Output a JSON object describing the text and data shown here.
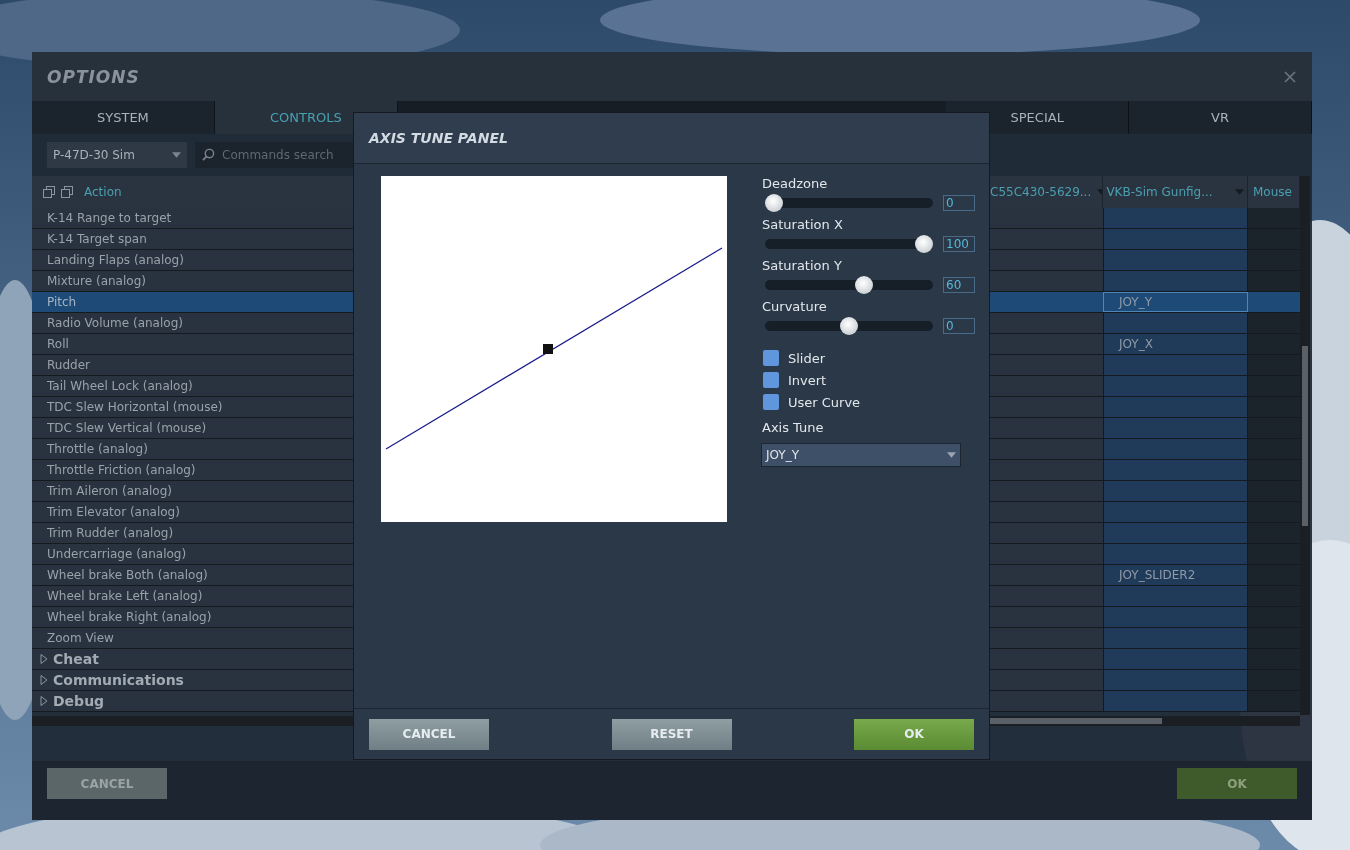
{
  "window": {
    "title": "OPTIONS"
  },
  "tabs": [
    {
      "label": "SYSTEM",
      "selected": false
    },
    {
      "label": "CONTROLS",
      "selected": true
    },
    {
      "label": "SPECIAL",
      "selected": false
    },
    {
      "label": "VR",
      "selected": false
    }
  ],
  "aircraft": {
    "value": "P-47D-30 Sim"
  },
  "search": {
    "placeholder": "Commands search"
  },
  "table": {
    "columns": [
      {
        "label": "Action"
      },
      {
        "label": "C55C430-5629..."
      },
      {
        "label": "VKB-Sim Gunfig..."
      },
      {
        "label": "Mouse"
      }
    ],
    "rows": [
      {
        "kind": "action",
        "action": "K-14 Range to target",
        "selected": false
      },
      {
        "kind": "action",
        "action": "K-14 Target span",
        "selected": false
      },
      {
        "kind": "action",
        "action": "Landing Flaps (analog)",
        "selected": false
      },
      {
        "kind": "action",
        "action": "Mixture (analog)",
        "selected": false
      },
      {
        "kind": "action",
        "action": "Pitch",
        "selected": true,
        "vkb": "JOY_Y"
      },
      {
        "kind": "action",
        "action": "Radio Volume (analog)",
        "selected": false
      },
      {
        "kind": "action",
        "action": "Roll",
        "selected": false,
        "vkb": "JOY_X"
      },
      {
        "kind": "action",
        "action": "Rudder",
        "selected": false
      },
      {
        "kind": "action",
        "action": "Tail Wheel Lock (analog)",
        "selected": false
      },
      {
        "kind": "action",
        "action": "TDC Slew Horizontal (mouse)",
        "selected": false
      },
      {
        "kind": "action",
        "action": "TDC Slew Vertical (mouse)",
        "selected": false
      },
      {
        "kind": "action",
        "action": "Throttle (analog)",
        "selected": false
      },
      {
        "kind": "action",
        "action": "Throttle Friction (analog)",
        "selected": false
      },
      {
        "kind": "action",
        "action": "Trim Aileron (analog)",
        "selected": false
      },
      {
        "kind": "action",
        "action": "Trim Elevator (analog)",
        "selected": false
      },
      {
        "kind": "action",
        "action": "Trim Rudder (analog)",
        "selected": false
      },
      {
        "kind": "action",
        "action": "Undercarriage (analog)",
        "selected": false
      },
      {
        "kind": "action",
        "action": "Wheel brake Both (analog)",
        "selected": false,
        "vkb": "JOY_SLIDER2"
      },
      {
        "kind": "action",
        "action": "Wheel brake Left (analog)",
        "selected": false
      },
      {
        "kind": "action",
        "action": "Wheel brake Right (analog)",
        "selected": false
      },
      {
        "kind": "action",
        "action": "Zoom View",
        "selected": false
      },
      {
        "kind": "category",
        "action": "Cheat",
        "expanded": false
      },
      {
        "kind": "category",
        "action": "Communications",
        "expanded": false
      },
      {
        "kind": "category",
        "action": "Debug",
        "expanded": false
      }
    ]
  },
  "buttons": [
    {
      "label": "CANCEL",
      "kind": "cancel"
    },
    {
      "label": "OK",
      "kind": "ok"
    }
  ],
  "dialog": {
    "title": "AXIS TUNE PANEL",
    "sliders": [
      {
        "label": "Deadzone",
        "level": 0,
        "value": "0"
      },
      {
        "label": "Saturation X",
        "level": 1,
        "value": "100"
      },
      {
        "label": "Saturation Y",
        "level": 0.6,
        "value": "60"
      },
      {
        "label": "Curvature",
        "level": 0.5,
        "value": "0"
      }
    ],
    "options": [
      {
        "label": "Slider",
        "checked": false
      },
      {
        "label": "Invert",
        "checked": false
      },
      {
        "label": "User Curve",
        "checked": false
      }
    ],
    "axis_tune": {
      "label": "Axis Tune",
      "value": "JOY_Y"
    },
    "buttons": [
      {
        "label": "CANCEL",
        "kind": "cancel"
      },
      {
        "label": "RESET",
        "kind": "reset"
      },
      {
        "label": "OK",
        "kind": "ok"
      }
    ]
  }
}
